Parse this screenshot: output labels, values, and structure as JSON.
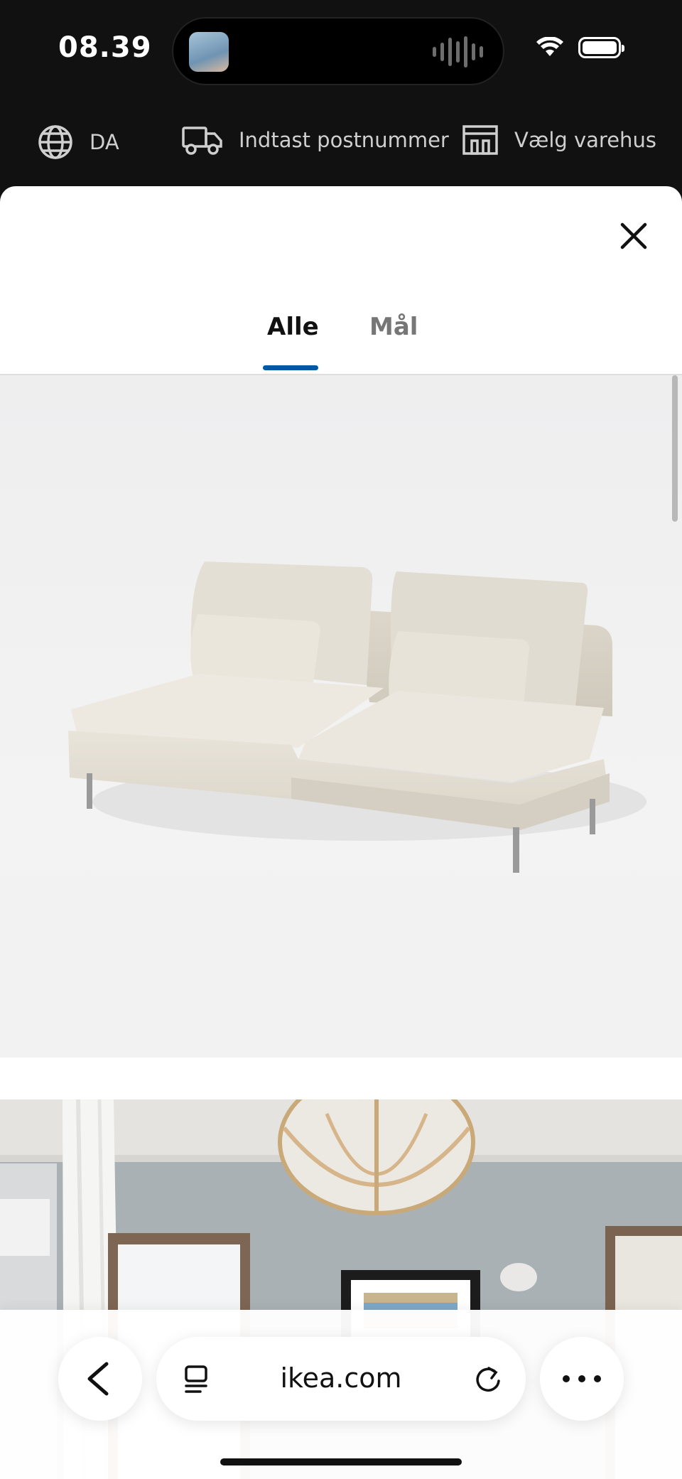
{
  "status_bar": {
    "time": "08.39",
    "icons": [
      "wifi-icon",
      "battery-icon",
      "audio-wave-icon"
    ]
  },
  "topbar": {
    "language": "DA",
    "postcode": "Indtast postnummer",
    "store": "Vælg varehus",
    "icons": [
      "globe-icon",
      "truck-icon",
      "store-icon"
    ]
  },
  "gallery": {
    "tabs": [
      {
        "label": "Alle",
        "active": true
      },
      {
        "label": "Mål",
        "active": false
      }
    ],
    "accent_color": "#0058a3",
    "images": [
      "sofa-product-image",
      "living-room-image"
    ]
  },
  "browser": {
    "url": "ikea.com",
    "icons": [
      "chevron-left-icon",
      "reader-icon",
      "reload-icon",
      "more-icon"
    ]
  }
}
